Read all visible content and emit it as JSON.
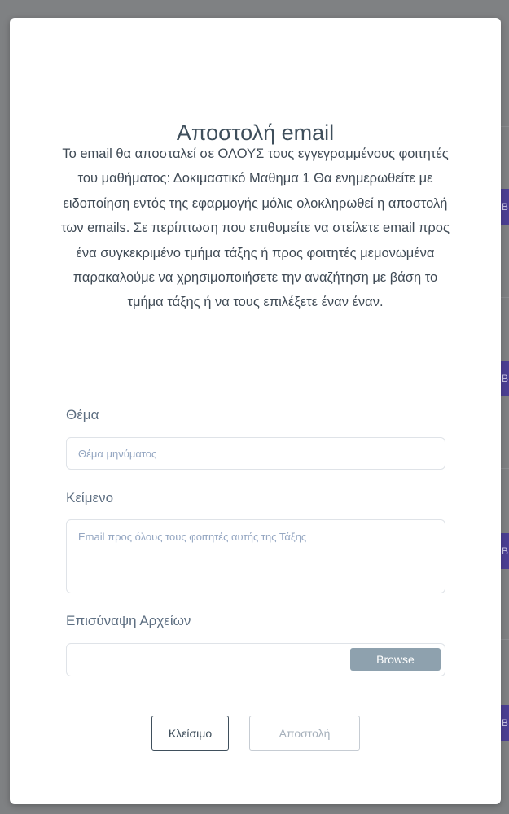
{
  "modal": {
    "title": "Αποστολή email",
    "description": "Το email θα αποσταλεί σε ΟΛΟΥΣ τους εγγεγραμμένους φοιτητές του μαθήματος: Δοκιμαστικό Μαθημα 1 Θα ενημερωθείτε με ειδοποίηση εντός της εφαρμογής μόλις ολοκληρωθεί η αποστολή των emails. Σε περίπτωση που επιθυμείτε να στείλετε email προς ένα συγκεκριμένο τμήμα τάξης ή προς φοιτητές μεμονωμένα παρακαλούμε να χρησιμοποιήσετε την αναζήτηση με βάση το τμήμα τάξης ή να τους επιλέξετε έναν έναν."
  },
  "subject": {
    "label": "Θέμα",
    "placeholder": "Θέμα μηνύματος",
    "value": ""
  },
  "body": {
    "label": "Κείμενο",
    "placeholder": "Email προς όλους τους φοιτητές αυτής της Τάξης",
    "value": ""
  },
  "attachments": {
    "label": "Επισύναψη Αρχείων",
    "browse_label": "Browse"
  },
  "buttons": {
    "close_label": "Κλείσιμο",
    "send_label": "Αποστολή"
  },
  "background": {
    "tag_letter": "B"
  },
  "colors": {
    "title": "#3f4f5c",
    "label": "#5e6f82",
    "placeholder": "#95a7c2",
    "browse_button": "#8ea1ae",
    "background_accent": "#4b3f93"
  }
}
